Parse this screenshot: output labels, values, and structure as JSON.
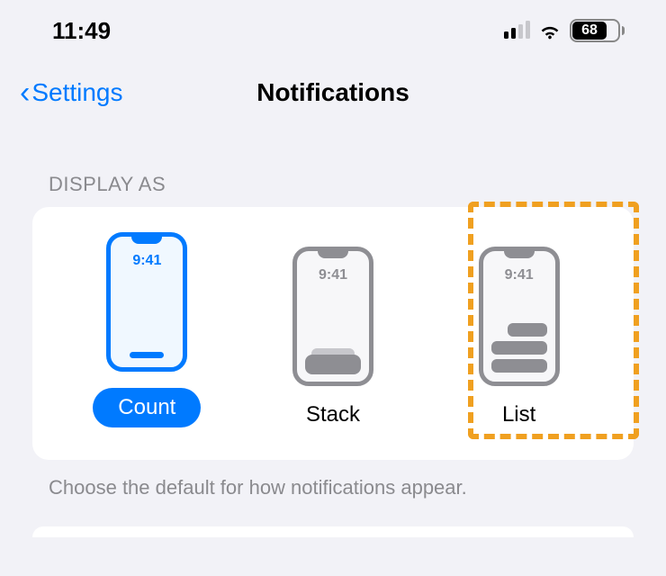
{
  "status": {
    "time": "11:49",
    "battery": "68"
  },
  "nav": {
    "back": "Settings",
    "title": "Notifications"
  },
  "section": {
    "header": "DISPLAY AS",
    "footer": "Choose the default for how notifications appear."
  },
  "options": {
    "phone_time": "9:41",
    "count": "Count",
    "stack": "Stack",
    "list": "List"
  }
}
